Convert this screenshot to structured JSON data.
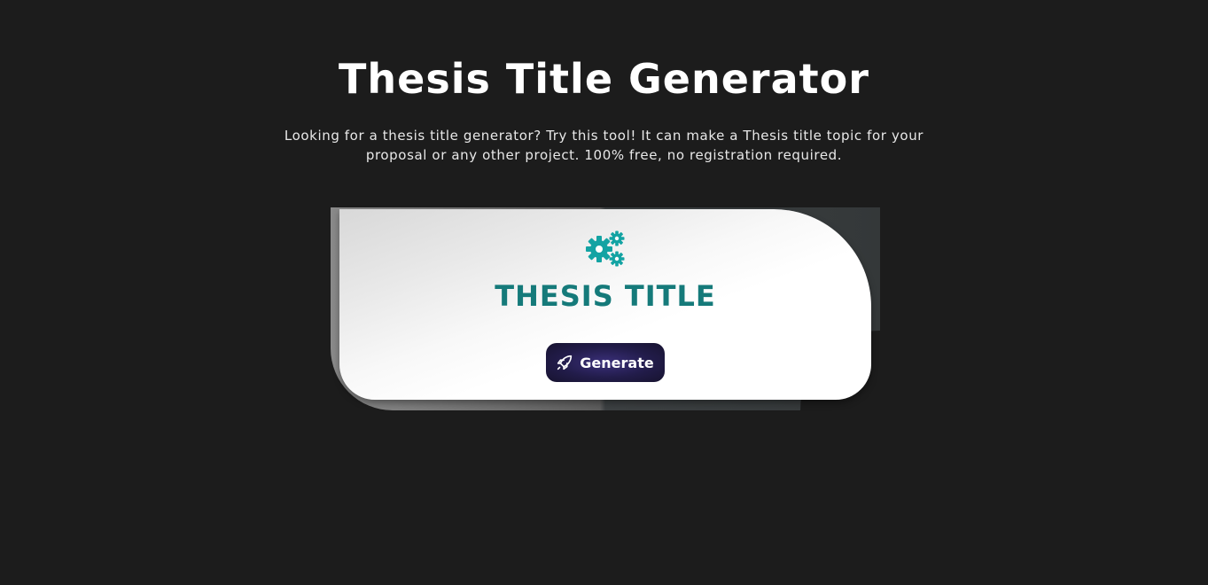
{
  "header": {
    "title": "Thesis Title Generator",
    "description": "Looking for a thesis title generator? Try this tool! It can make a Thesis title topic for your proposal or any other project. 100% free, no registration required."
  },
  "card": {
    "icon": "gears-icon",
    "heading": "THESIS TITLE",
    "generate_label": "Generate",
    "generate_icon": "rocket-icon"
  },
  "colors": {
    "background": "#1c1c1c",
    "heading_teal": "#157a7a",
    "gear_teal": "#13a3a3",
    "button_dark": "#221c4a"
  }
}
